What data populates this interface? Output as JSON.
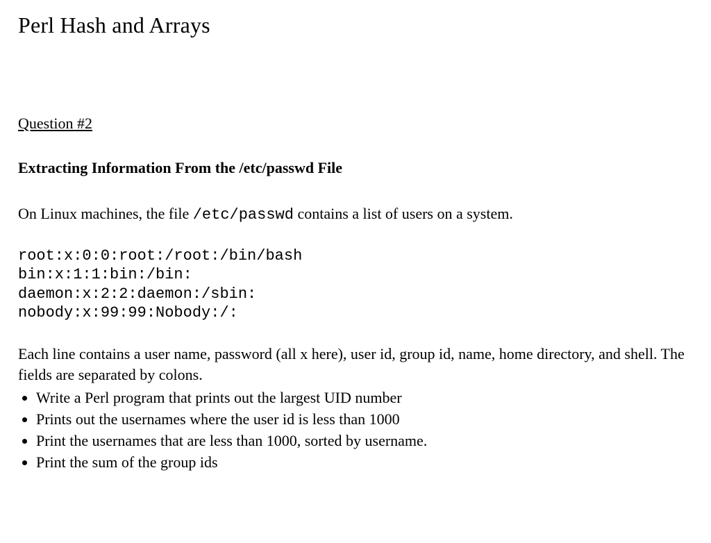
{
  "title": "Perl Hash and Arrays",
  "question_label": "Question #2",
  "subheading": "Extracting Information From the  /etc/passwd File",
  "intro_pre": "On Linux machines, the file ",
  "intro_code": "/etc/passwd",
  "intro_post": " contains a list of users on a system.",
  "code": "root:x:0:0:root:/root:/bin/bash\nbin:x:1:1:bin:/bin:\ndaemon:x:2:2:daemon:/sbin:\nnobody:x:99:99:Nobody:/:",
  "explain": "Each line contains a user name, password (all x here), user id, group id, name, home directory, and shell. The fields are separated by colons.",
  "bullets": [
    "Write a Perl program that prints out the largest UID number",
    "Prints out the usernames where the user id is less than 1000",
    "Print the usernames that are less than 1000, sorted by username.",
    "Print the sum of the group ids"
  ]
}
